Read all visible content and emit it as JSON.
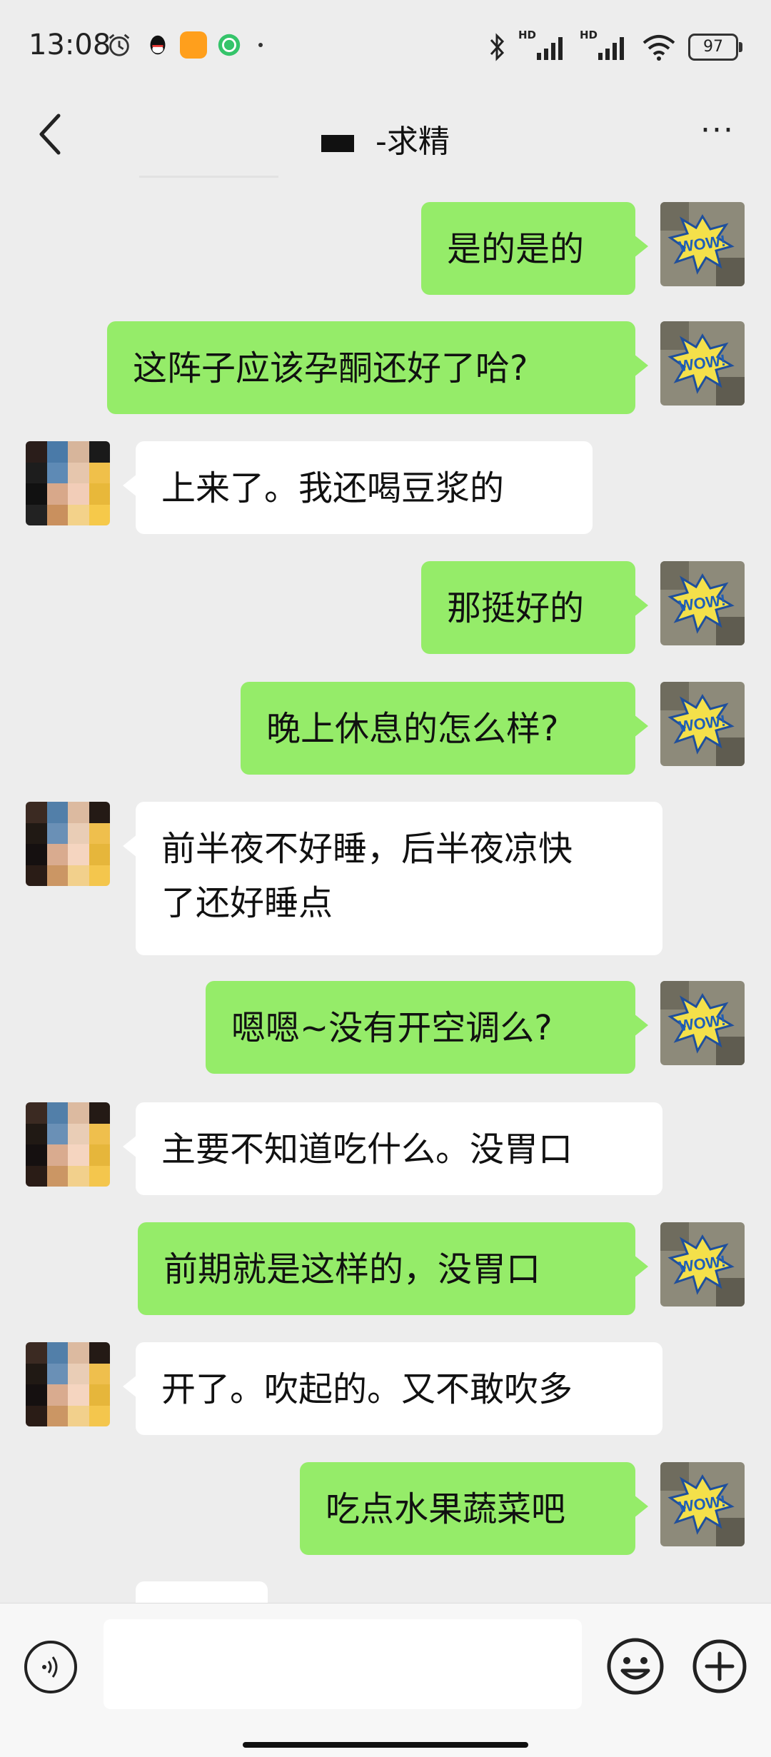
{
  "status_bar": {
    "time": "13:08",
    "battery": "97",
    "network_label": "HD"
  },
  "header": {
    "title": "-求精",
    "back_icon": "chevron-left-icon",
    "more_icon": "more-dots-icon"
  },
  "messages": [
    {
      "sender": "me",
      "text": "是的是的"
    },
    {
      "sender": "me",
      "text": "这阵子应该孕酮还好了哈?"
    },
    {
      "sender": "them",
      "text": "上来了。我还喝豆浆的"
    },
    {
      "sender": "me",
      "text": "那挺好的"
    },
    {
      "sender": "me",
      "text": "晚上休息的怎么样?"
    },
    {
      "sender": "them",
      "text": "前半夜不好睡，后半夜凉快\n了还好睡点"
    },
    {
      "sender": "me",
      "text": "嗯嗯~没有开空调么?"
    },
    {
      "sender": "them",
      "text": "主要不知道吃什么。没胃口"
    },
    {
      "sender": "me",
      "text": "前期就是这样的，没胃口"
    },
    {
      "sender": "them",
      "text": "开了。吹起的。又不敢吹多"
    },
    {
      "sender": "me",
      "text": "吃点水果蔬菜吧"
    }
  ],
  "my_avatar_text": "WOW!",
  "input_bar": {
    "value": "",
    "placeholder": ""
  },
  "colors": {
    "my_bubble": "#95ec69",
    "their_bubble": "#ffffff",
    "background": "#ededed"
  }
}
